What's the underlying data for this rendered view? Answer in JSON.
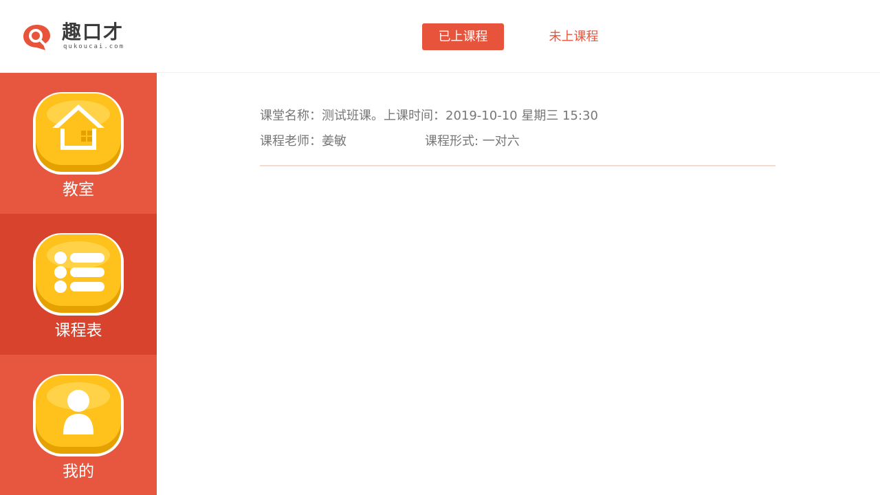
{
  "header": {
    "logo": {
      "name": "趣口才",
      "domain": "qukoucai.com",
      "icon": "speech-bubble-search-icon"
    },
    "tabs": [
      {
        "label": "已上课程",
        "active": true
      },
      {
        "label": "未上课程",
        "active": false
      }
    ]
  },
  "sidebar": {
    "items": [
      {
        "label": "教室",
        "icon": "house-icon",
        "active": false
      },
      {
        "label": "课程表",
        "icon": "list-icon",
        "active": true
      },
      {
        "label": "我的",
        "icon": "user-icon",
        "active": false
      }
    ]
  },
  "course": {
    "title_line": "课堂名称：测试班课。上课时间：2019-10-10 星期三 15:30",
    "teacher": "课程老师：姜敏",
    "format": "课程形式: 一对六"
  },
  "colors": {
    "accent": "#e8533b",
    "sidebar_bg": "#e7563f",
    "sidebar_active_bg": "#d8432d",
    "icon_yellow": "#ffc21c",
    "divider": "#f8d9cf"
  }
}
